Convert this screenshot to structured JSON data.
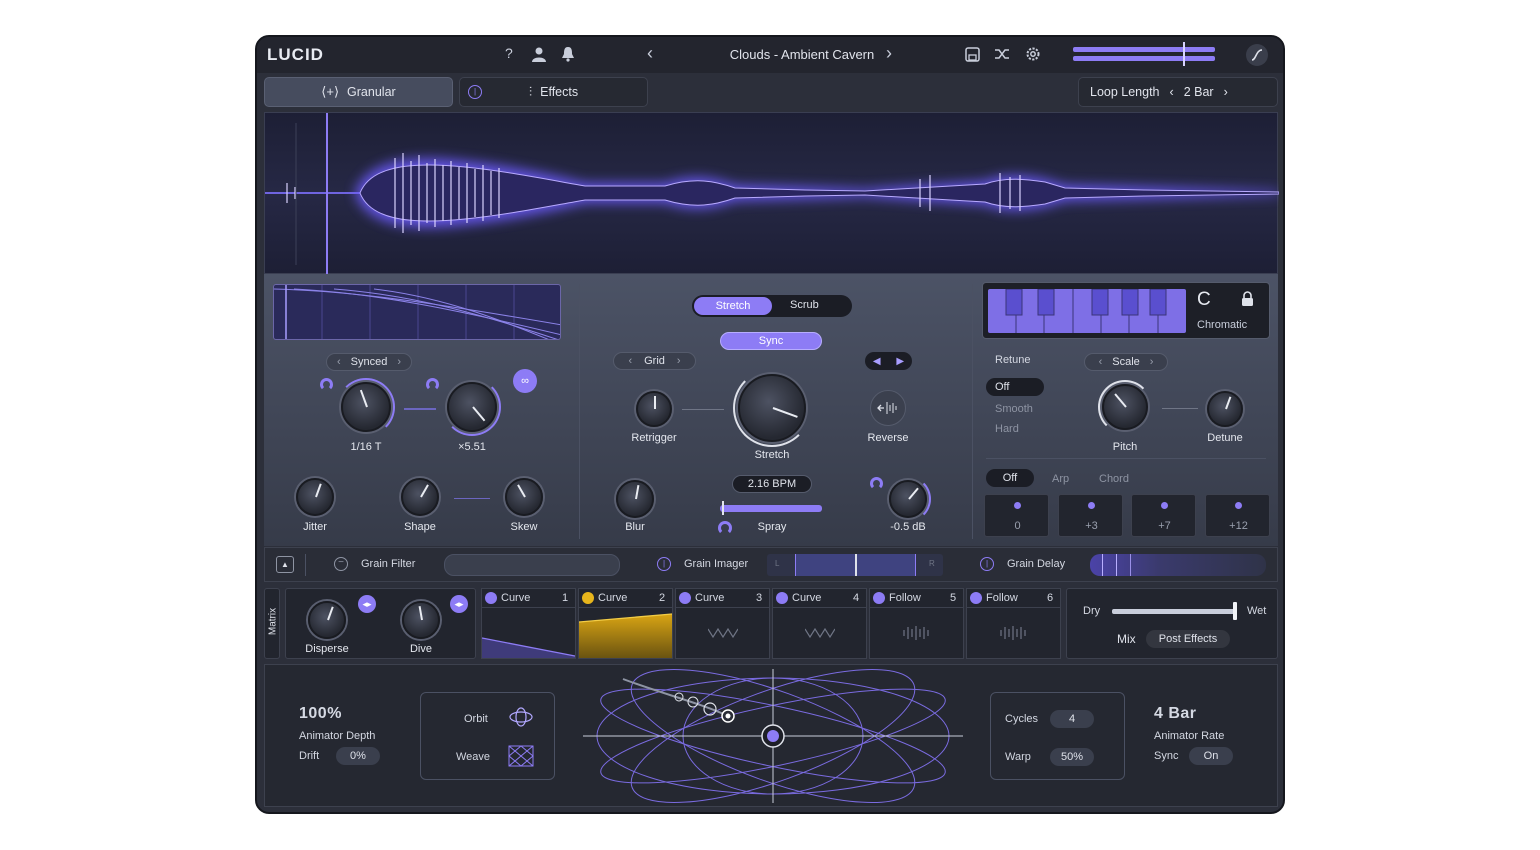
{
  "app": {
    "logo": "LUCID"
  },
  "topbar": {
    "help_icon": "?",
    "preset_name": "Clouds - Ambient Cavern",
    "prev_icon": "‹",
    "next_icon": "›"
  },
  "tabs": [
    {
      "label": "Granular",
      "icon": "granular-icon"
    },
    {
      "label": "Effects",
      "icon": "sliders-icon"
    }
  ],
  "loop": {
    "label": "Loop Length",
    "value": "2 Bar"
  },
  "left": {
    "sync_mode": "Synced",
    "knob_rate": "1/16 T",
    "knob_mult": "×5.51",
    "jitter": "Jitter",
    "shape": "Shape",
    "skew": "Skew"
  },
  "center": {
    "mode_stretch": "Stretch",
    "mode_scrub": "Scrub",
    "sync": "Sync",
    "grid": "Grid",
    "retrigger": "Retrigger",
    "stretch": "Stretch",
    "reverse": "Reverse",
    "bpm": "2.16 BPM",
    "blur": "Blur",
    "spray": "Spray",
    "gain": "-0.5 dB"
  },
  "right": {
    "key": "C",
    "scale_name": "Chromatic",
    "retune": "Retune",
    "scale": "Scale",
    "retune_opts": [
      "Off",
      "Smooth",
      "Hard"
    ],
    "pitch": "Pitch",
    "detune": "Detune",
    "chord_modes": [
      "Off",
      "Arp",
      "Chord"
    ],
    "intervals": [
      "0",
      "+3",
      "+7",
      "+12"
    ]
  },
  "filterbar": {
    "grain_filter": "Grain Filter",
    "grain_imager": "Grain Imager",
    "imager_l": "L",
    "imager_r": "R",
    "grain_delay": "Grain Delay"
  },
  "matrix": {
    "label": "Matrix",
    "disperse": "Disperse",
    "dive": "Dive",
    "slots": [
      {
        "type": "Curve",
        "num": "1"
      },
      {
        "type": "Curve",
        "num": "2"
      },
      {
        "type": "Curve",
        "num": "3"
      },
      {
        "type": "Curve",
        "num": "4"
      },
      {
        "type": "Follow",
        "num": "5"
      },
      {
        "type": "Follow",
        "num": "6"
      }
    ],
    "dry": "Dry",
    "wet": "Wet",
    "mix": "Mix",
    "post_effects": "Post Effects"
  },
  "animator": {
    "depth_value": "100%",
    "depth_label": "Animator Depth",
    "drift_label": "Drift",
    "drift_value": "0%",
    "orbit": "Orbit",
    "weave": "Weave",
    "cycles_label": "Cycles",
    "cycles_value": "4",
    "warp_label": "Warp",
    "warp_value": "50%",
    "rate_value": "4 Bar",
    "rate_label": "Animator Rate",
    "sync_label": "Sync",
    "sync_value": "On"
  },
  "colors": {
    "accent": "#8d7cf5",
    "yellow": "#e7b51c",
    "panel": "#2c2f3a"
  }
}
